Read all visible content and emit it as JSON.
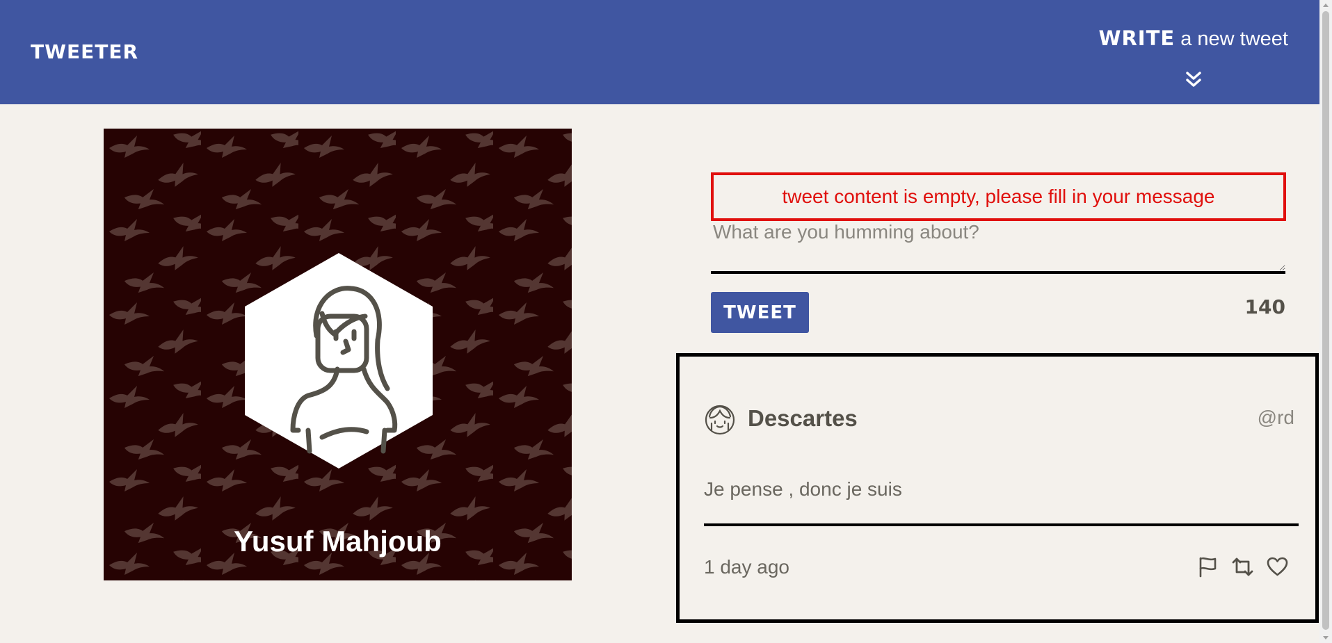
{
  "header": {
    "brand": "TWEETER",
    "compose_strong": "WRITE",
    "compose_rest": " a new tweet",
    "toggle_icon": "double-chevron-down-icon",
    "background_color": "#4056a1"
  },
  "profile": {
    "name": "Yusuf Mahjoub",
    "background_color": "#260303",
    "pattern_icon": "bird-icon"
  },
  "compose": {
    "error_message": "tweet content is empty, please fill in your message",
    "placeholder": "What are you humming about?",
    "value": "",
    "submit_label": "TWEET",
    "char_counter": "140",
    "error_color": "#e0100d"
  },
  "tweets": [
    {
      "author": "Descartes",
      "handle": "@rd",
      "content": "Je pense , donc je suis",
      "time": "1 day ago",
      "actions": [
        "flag-icon",
        "retweet-icon",
        "heart-icon"
      ]
    }
  ]
}
